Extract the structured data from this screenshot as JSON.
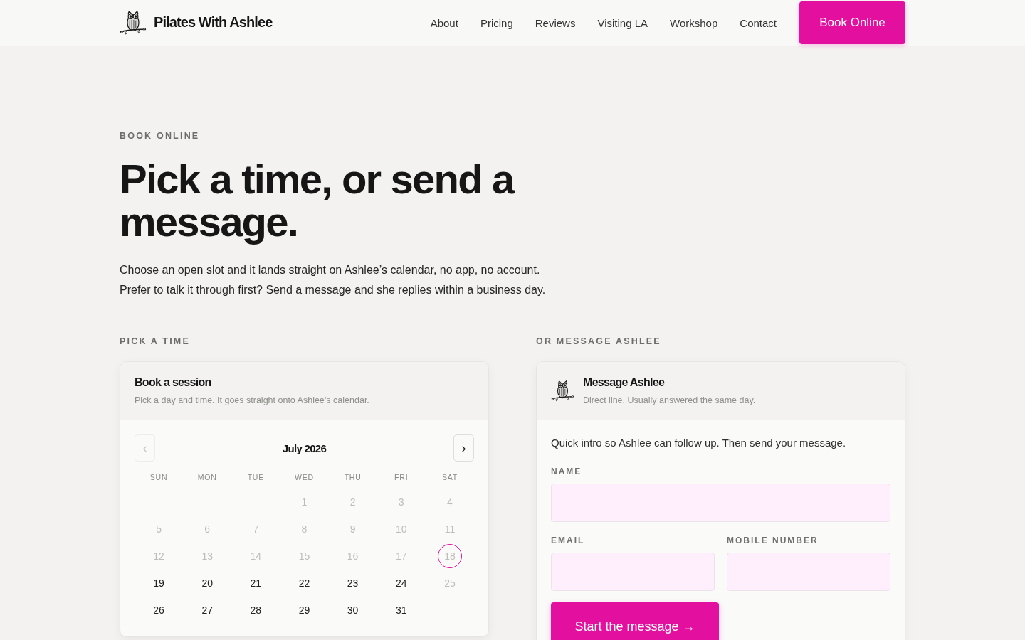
{
  "header": {
    "brand": "Pilates With Ashlee",
    "nav": [
      "About",
      "Pricing",
      "Reviews",
      "Visiting LA",
      "Workshop",
      "Contact"
    ],
    "cta": "Book Online"
  },
  "hero": {
    "eyebrow": "BOOK ONLINE",
    "title": "Pick a time, or send a message.",
    "intro": [
      "Choose an open slot and it lands straight on Ashlee’s calendar, no app, no account.",
      "Prefer to talk it through first? Send a message and she replies within a business day."
    ]
  },
  "booking": {
    "section_label": "PICK A TIME",
    "title": "Book a session",
    "subtitle": "Pick a day and time. It goes straight onto Ashlee’s calendar.",
    "calendar": {
      "month": "July 2026",
      "prev": {
        "symbol": "‹",
        "disabled": true
      },
      "next": {
        "symbol": "›",
        "disabled": false
      },
      "weekdays": [
        "SUN",
        "MON",
        "TUE",
        "WED",
        "THU",
        "FRI",
        "SAT"
      ],
      "weeks": [
        [
          {
            "kind": "blank"
          },
          {
            "kind": "blank"
          },
          {
            "kind": "blank"
          },
          {
            "kind": "day",
            "label": "1",
            "disabled": true,
            "today": false
          },
          {
            "kind": "day",
            "label": "2",
            "disabled": true,
            "today": false
          },
          {
            "kind": "day",
            "label": "3",
            "disabled": true,
            "today": false
          },
          {
            "kind": "day",
            "label": "4",
            "disabled": true,
            "today": false
          }
        ],
        [
          {
            "kind": "day",
            "label": "5",
            "disabled": true,
            "today": false
          },
          {
            "kind": "day",
            "label": "6",
            "disabled": true,
            "today": false
          },
          {
            "kind": "day",
            "label": "7",
            "disabled": true,
            "today": false
          },
          {
            "kind": "day",
            "label": "8",
            "disabled": true,
            "today": false
          },
          {
            "kind": "day",
            "label": "9",
            "disabled": true,
            "today": false
          },
          {
            "kind": "day",
            "label": "10",
            "disabled": true,
            "today": false
          },
          {
            "kind": "day",
            "label": "11",
            "disabled": true,
            "today": false
          }
        ],
        [
          {
            "kind": "day",
            "label": "12",
            "disabled": true,
            "today": false
          },
          {
            "kind": "day",
            "label": "13",
            "disabled": true,
            "today": false
          },
          {
            "kind": "day",
            "label": "14",
            "disabled": true,
            "today": false
          },
          {
            "kind": "day",
            "label": "15",
            "disabled": true,
            "today": false
          },
          {
            "kind": "day",
            "label": "16",
            "disabled": true,
            "today": false
          },
          {
            "kind": "day",
            "label": "17",
            "disabled": true,
            "today": false
          },
          {
            "kind": "day",
            "label": "18",
            "disabled": true,
            "today": true
          }
        ],
        [
          {
            "kind": "day",
            "label": "19",
            "disabled": false,
            "today": false
          },
          {
            "kind": "day",
            "label": "20",
            "disabled": false,
            "today": false
          },
          {
            "kind": "day",
            "label": "21",
            "disabled": false,
            "today": false
          },
          {
            "kind": "day",
            "label": "22",
            "disabled": false,
            "today": false
          },
          {
            "kind": "day",
            "label": "23",
            "disabled": false,
            "today": false
          },
          {
            "kind": "day",
            "label": "24",
            "disabled": false,
            "today": false
          },
          {
            "kind": "day",
            "label": "25",
            "disabled": true,
            "today": false
          }
        ],
        [
          {
            "kind": "day",
            "label": "26",
            "disabled": false,
            "today": false
          },
          {
            "kind": "day",
            "label": "27",
            "disabled": false,
            "today": false
          },
          {
            "kind": "day",
            "label": "28",
            "disabled": false,
            "today": false
          },
          {
            "kind": "day",
            "label": "29",
            "disabled": false,
            "today": false
          },
          {
            "kind": "day",
            "label": "30",
            "disabled": false,
            "today": false
          },
          {
            "kind": "day",
            "label": "31",
            "disabled": false,
            "today": false
          }
        ]
      ]
    }
  },
  "message": {
    "section_label": "OR MESSAGE ASHLEE",
    "title": "Message Ashlee",
    "subtitle": "Direct line. Usually answered the same day.",
    "intro": "Quick intro so Ashlee can follow up. Then send your message.",
    "fields": [
      {
        "kind": "text",
        "label": "NAME"
      },
      {
        "kind": "email",
        "label": "EMAIL"
      },
      {
        "kind": "tel",
        "label": "MOBILE NUMBER"
      }
    ],
    "submit": "Start the message →"
  }
}
